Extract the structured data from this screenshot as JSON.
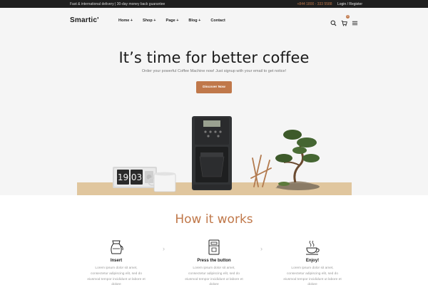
{
  "topbar": {
    "promo": "Fast & international delivery | 30-day money back guarantee",
    "phone": "+844 1800 - 333 5588",
    "login": "Login / Register"
  },
  "header": {
    "logo": "Smartic'",
    "nav": [
      "Home +",
      "Shop +",
      "Page +",
      "Blog +",
      "Contact"
    ],
    "cart_count": "0",
    "icons": [
      "search-icon",
      "cart-icon",
      "menu-icon"
    ]
  },
  "hero": {
    "title": "It’s time for better coffee",
    "subtitle": "Order your powerful Coffee Machine now! Just signup with your email to get notice!",
    "button": "Discover Now",
    "clock": {
      "hour": "19",
      "minute": "03"
    }
  },
  "how": {
    "title": "How it works",
    "steps": [
      {
        "icon": "coffee-pot-icon",
        "title": "Insert",
        "text": "Lorem ipsum dolor sit amet, consectetur adipiscing elit, sed do eiusmod tempor incididunt ut labore et dolore"
      },
      {
        "icon": "coffee-machine-icon",
        "title": "Press the button",
        "text": "Lorem ipsum dolor sit amet, consectetur adipiscing elit, sed do eiusmod tempor incididunt ut labore et dolore"
      },
      {
        "icon": "coffee-cup-icon",
        "title": "Enjoy!",
        "text": "Lorem ipsum dolor sit amet, consectetur adipiscing elit, sed do eiusmod tempor incididunt ut labore et dolore"
      }
    ]
  },
  "colors": {
    "accent": "#c0784a",
    "topbar": "#1f1f1f",
    "hero_bg": "#f5f5f5",
    "table": "#e0c69e"
  }
}
